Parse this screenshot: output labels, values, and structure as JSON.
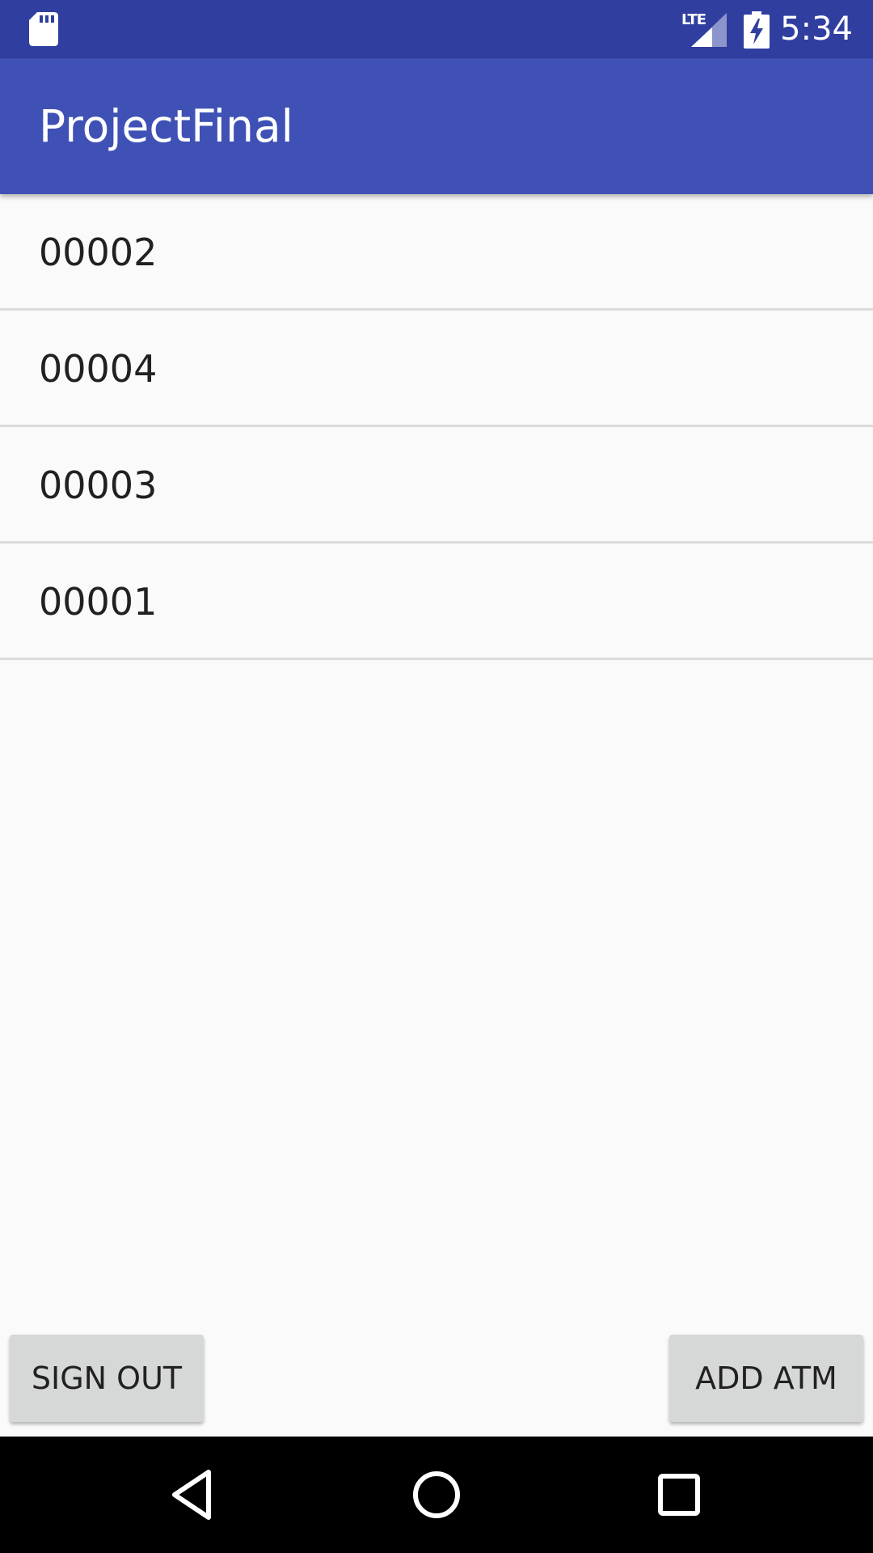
{
  "status_bar": {
    "time": "5:34",
    "network_label": "LTE",
    "icons": [
      "sd-card-icon",
      "signal-icon",
      "battery-charging-icon"
    ]
  },
  "app_bar": {
    "title": "ProjectFinal"
  },
  "atm_list": {
    "items": [
      {
        "label": "00002"
      },
      {
        "label": "00004"
      },
      {
        "label": "00003"
      },
      {
        "label": "00001"
      }
    ]
  },
  "actions": {
    "sign_out_label": "SIGN OUT",
    "add_atm_label": "ADD ATM"
  },
  "nav_bar": {
    "icons": [
      "back-icon",
      "home-icon",
      "recents-icon"
    ]
  },
  "colors": {
    "status_bar": "#303f9f",
    "app_bar": "#3f51b5",
    "background": "#fafafa",
    "button": "#d6d7d7",
    "divider": "#dcdcdc",
    "text_primary": "#212121",
    "nav_bar": "#000000"
  }
}
